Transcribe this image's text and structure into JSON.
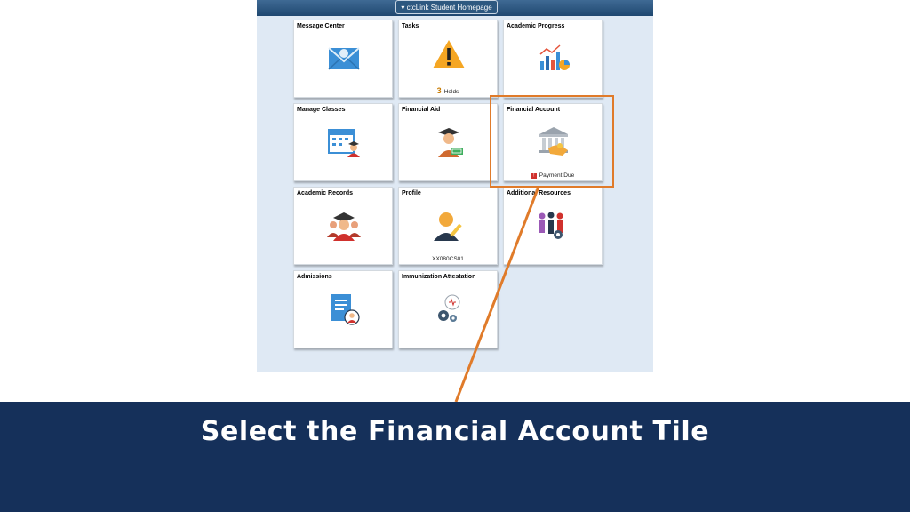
{
  "header": {
    "homepage_label": "▾ ctcLink Student Homepage"
  },
  "tiles": {
    "message_center": {
      "title": "Message Center",
      "icon": "envelope-icon"
    },
    "tasks": {
      "title": "Tasks",
      "icon": "warning-icon",
      "count": "3",
      "sub": "Holds"
    },
    "academic_progress": {
      "title": "Academic Progress",
      "icon": "chart-icon"
    },
    "manage_classes": {
      "title": "Manage Classes",
      "icon": "calendar-student-icon"
    },
    "financial_aid": {
      "title": "Financial Aid",
      "icon": "graduate-money-icon"
    },
    "financial_account": {
      "title": "Financial Account",
      "icon": "bank-hand-icon",
      "alert_icon": "!",
      "sub": "Payment Due"
    },
    "academic_records": {
      "title": "Academic Records",
      "icon": "graduates-icon"
    },
    "profile": {
      "title": "Profile",
      "icon": "person-pencil-icon",
      "sub": "XX080CS01"
    },
    "additional_resources": {
      "title": "Additional Resources",
      "icon": "people-gear-icon"
    },
    "admissions": {
      "title": "Admissions",
      "icon": "document-person-icon"
    },
    "immunization": {
      "title": "Immunization Attestation",
      "icon": "gears-health-icon"
    }
  },
  "callout": {
    "text": "Select the Financial Account Tile",
    "color": "#e07b2a"
  },
  "colors": {
    "banner": "#15305a",
    "accent": "#e07b2a",
    "tile_bg": "#ffffff",
    "page_bg": "#dfe9f4"
  }
}
